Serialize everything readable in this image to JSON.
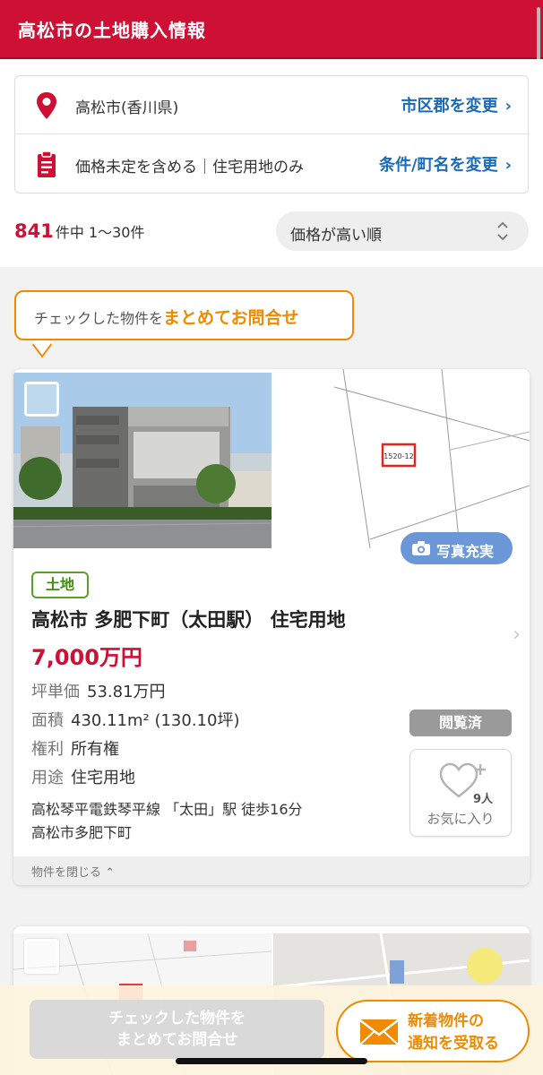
{
  "header": {
    "title": "高松市の土地購入情報"
  },
  "filters": {
    "location_text": "高松市(香川県)",
    "location_link": "市区郡を変更",
    "conditions_text": "価格未定を含める｜住宅用地のみ",
    "conditions_link": "条件/町名を変更"
  },
  "results": {
    "total": "841",
    "range_text": "件中 1〜30件",
    "sort_selected": "価格が高い順"
  },
  "batch_prompt": {
    "prefix": "チェックした物件を",
    "emphasis": "まとめてお問合せ"
  },
  "listing": {
    "photo_badge": "写真充実",
    "type_tag": "土地",
    "title": "高松市 多肥下町（太田駅） 住宅用地",
    "price": "7,000万円",
    "specs": [
      {
        "key": "坪単価",
        "value": "53.81万円"
      },
      {
        "key": "面積",
        "value": "430.11m² (130.10坪)"
      },
      {
        "key": "権利",
        "value": "所有権"
      },
      {
        "key": "用途",
        "value": "住宅用地"
      }
    ],
    "access": "高松琴平電鉄琴平線 「太田」駅 徒歩16分",
    "address": "高松市多肥下町",
    "viewed_badge": "閲覧済",
    "favorite_count": "9人",
    "favorite_label": "お気に入り",
    "collapse_label": "物件を閉じる",
    "map_label": "1520-12"
  },
  "bottom": {
    "inquiry_line1": "チェックした物件を",
    "inquiry_line2": "まとめてお問合せ",
    "notify_line1": "新着物件の",
    "notify_line2": "通知を受取る"
  },
  "colors": {
    "brand_red": "#ce1035",
    "link_blue": "#1a6bb8",
    "accent_orange": "#f08a00",
    "tag_green": "#5aa027"
  }
}
